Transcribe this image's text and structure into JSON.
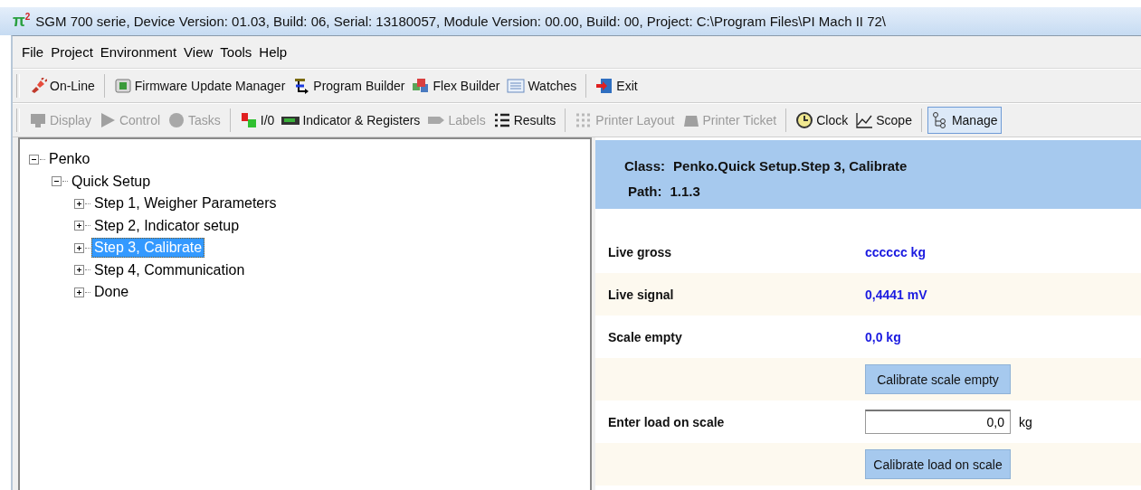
{
  "window": {
    "app_icon": "π$^{2}$",
    "title": "SGM 700 serie, Device Version: 01.03, Build: 06, Serial: 13180057, Module Version: 00.00, Build: 00, Project: C:\\Program Files\\PI Mach II 72\\"
  },
  "menu": [
    "File",
    "Project",
    "Environment",
    "View",
    "Tools",
    "Help"
  ],
  "toolbars": [
    {
      "groups": [
        [
          {
            "label": "On-Line",
            "disabled": false,
            "selected": false
          }
        ],
        [
          {
            "label": "Firmware Update Manager",
            "disabled": false,
            "selected": false
          },
          {
            "label": "Program Builder",
            "disabled": false,
            "selected": false
          },
          {
            "label": "Flex Builder",
            "disabled": false,
            "selected": false
          },
          {
            "label": "Watches",
            "disabled": false,
            "selected": false
          }
        ],
        [
          {
            "label": "Exit",
            "disabled": false,
            "selected": false
          }
        ]
      ]
    },
    {
      "groups": [
        [
          {
            "label": "Display",
            "disabled": true,
            "selected": false
          },
          {
            "label": "Control",
            "disabled": true,
            "selected": false
          },
          {
            "label": "Tasks",
            "disabled": true,
            "selected": false
          }
        ],
        [
          {
            "label": "I/0",
            "disabled": false,
            "selected": false
          },
          {
            "label": "Indicator & Registers",
            "disabled": false,
            "selected": false
          },
          {
            "label": "Labels",
            "disabled": true,
            "selected": false
          },
          {
            "label": "Results",
            "disabled": false,
            "selected": false
          }
        ],
        [
          {
            "label": "Printer Layout",
            "disabled": true,
            "selected": false
          },
          {
            "label": "Printer Ticket",
            "disabled": true,
            "selected": false
          }
        ],
        [
          {
            "label": "Clock",
            "disabled": false,
            "selected": false
          },
          {
            "label": "Scope",
            "disabled": false,
            "selected": false
          }
        ],
        [
          {
            "label": "Manage",
            "disabled": false,
            "selected": true
          }
        ]
      ]
    }
  ],
  "tree": [
    {
      "label": "Penko",
      "expanded": true,
      "selected": false,
      "children": [
        {
          "label": "Quick Setup",
          "expanded": true,
          "selected": false,
          "children": [
            {
              "label": "Step 1, Weigher Parameters",
              "expanded": false,
              "selected": false
            },
            {
              "label": "Step 2, Indicator setup",
              "expanded": false,
              "selected": false
            },
            {
              "label": "Step 3, Calibrate",
              "expanded": false,
              "selected": true
            },
            {
              "label": "Step 4, Communication",
              "expanded": false,
              "selected": false
            },
            {
              "label": "Done",
              "expanded": false,
              "selected": false
            }
          ]
        }
      ]
    }
  ],
  "details": {
    "class_label": "Class:",
    "class_value": "Penko.Quick Setup.Step 3, Calibrate",
    "path_label": "Path:",
    "path_value": "1.1.3",
    "rows": [
      {
        "kind": "value",
        "label": "Live gross",
        "value": "cccccc kg"
      },
      {
        "kind": "value",
        "label": "Live signal",
        "value": "0,4441 mV"
      },
      {
        "kind": "value",
        "label": "Scale empty",
        "value": "0,0 kg"
      },
      {
        "kind": "button",
        "button": "Calibrate scale empty"
      },
      {
        "kind": "input",
        "label": "Enter load on scale",
        "value": "0,0",
        "unit": "kg"
      },
      {
        "kind": "button",
        "button": "Calibrate load on scale"
      }
    ]
  }
}
